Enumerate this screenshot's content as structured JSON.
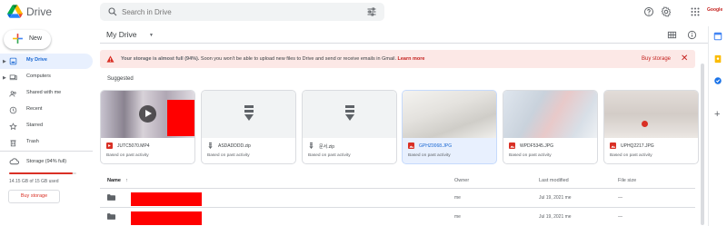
{
  "app": {
    "title": "Drive"
  },
  "search": {
    "placeholder": "Search in Drive"
  },
  "new_button": {
    "label": "New"
  },
  "avatar": {
    "text": "Google"
  },
  "sidebar": {
    "items": [
      {
        "label": "My Drive",
        "icon": "drive-icon",
        "active": true
      },
      {
        "label": "Computers",
        "icon": "computer-icon",
        "active": false
      },
      {
        "label": "Shared with me",
        "icon": "people-icon",
        "active": false
      },
      {
        "label": "Recent",
        "icon": "clock-icon",
        "active": false
      },
      {
        "label": "Starred",
        "icon": "star-icon",
        "active": false
      },
      {
        "label": "Trash",
        "icon": "trash-icon",
        "active": false
      }
    ],
    "storage_label": "Storage (94% full)",
    "storage_used_text": "14.15 GB of 15 GB used",
    "storage_fraction": 0.94,
    "buy_storage": "Buy storage"
  },
  "main": {
    "title": "My Drive",
    "banner": {
      "heading": "Your storage is almost full (94%).",
      "text": "Soon you won't be able to upload new files to Drive and send or receive emails in Gmail.",
      "link": "Learn more",
      "buy": "Buy storage",
      "close": "✕"
    },
    "suggested_label": "Suggested",
    "suggested": [
      {
        "name": "JUTC5070.MP4",
        "type": "video",
        "activity": "Based on past activity",
        "selected": false
      },
      {
        "name": "ASDADDDD.zip",
        "type": "zip",
        "activity": "Based on past activity",
        "selected": false
      },
      {
        "name": "문서.zip",
        "type": "zip",
        "activity": "Based on past activity",
        "selected": false
      },
      {
        "name": "GPHZ0068.JPG",
        "type": "image",
        "activity": "Based on past activity",
        "selected": true
      },
      {
        "name": "WPDF5345.JPG",
        "type": "image",
        "activity": "Based on past activity",
        "selected": false
      },
      {
        "name": "UPHQ2217.JPG",
        "type": "image",
        "activity": "Based on past activity",
        "selected": false
      }
    ],
    "list": {
      "headers": {
        "name": "Name",
        "sort": "↑",
        "owner": "Owner",
        "modified": "Last modified",
        "size": "File size"
      },
      "rows": [
        {
          "owner": "me",
          "modified": "Jul 19, 2021 me",
          "size": "—"
        },
        {
          "owner": "me",
          "modified": "Jul 19, 2021 me",
          "size": "—"
        }
      ]
    }
  },
  "colors": {
    "accent": "#1967d2",
    "danger": "#d93025",
    "banner_bg": "#fce8e6",
    "redaction": "#ff0000"
  }
}
